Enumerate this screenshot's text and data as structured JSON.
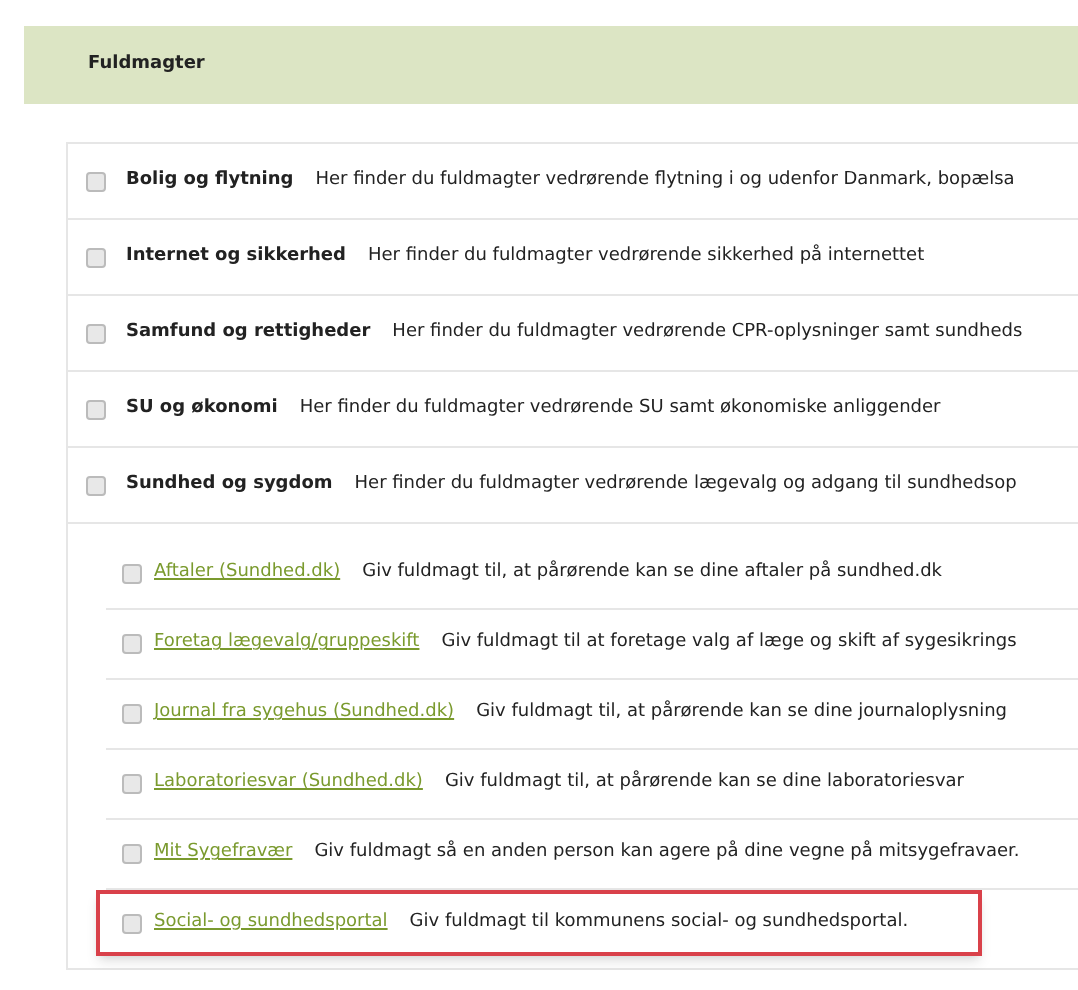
{
  "header": {
    "title": "Fuldmagter"
  },
  "categories": [
    {
      "label": "Bolig og flytning",
      "description": "Her finder du fuldmagter vedrørende flytning i og udenfor Danmark, bopælsa",
      "checked": false
    },
    {
      "label": "Internet og sikkerhed",
      "description": "Her finder du fuldmagter vedrørende sikkerhed på internettet",
      "checked": false
    },
    {
      "label": "Samfund og rettigheder",
      "description": "Her finder du fuldmagter vedrørende CPR-oplysninger samt sundheds",
      "checked": false
    },
    {
      "label": "SU og økonomi",
      "description": "Her finder du fuldmagter vedrørende SU samt økonomiske anliggender",
      "checked": false
    },
    {
      "label": "Sundhed og sygdom",
      "description": "Her finder du fuldmagter vedrørende lægevalg og adgang til sundhedsop",
      "checked": false,
      "children": [
        {
          "label": "Aftaler (Sundhed.dk)",
          "description": "Giv fuldmagt til, at pårørende kan se dine aftaler på sundhed.dk",
          "checked": false,
          "highlighted": false
        },
        {
          "label": "Foretag lægevalg/gruppeskift",
          "description": "Giv fuldmagt til at foretage valg af læge og skift af sygesikrings",
          "checked": false,
          "highlighted": false
        },
        {
          "label": "Journal fra sygehus (Sundhed.dk)",
          "description": "Giv fuldmagt til, at pårørende kan se dine journaloplysning",
          "checked": false,
          "highlighted": false
        },
        {
          "label": "Laboratoriesvar (Sundhed.dk)",
          "description": "Giv fuldmagt til, at pårørende kan se dine laboratoriesvar",
          "checked": false,
          "highlighted": false
        },
        {
          "label": "Mit Sygefravær",
          "description": "Giv fuldmagt så en anden person kan agere på dine vegne på mitsygefravaer.",
          "checked": false,
          "highlighted": false
        },
        {
          "label": "Social- og sundhedsportal",
          "description": "Giv fuldmagt til kommunens social- og sundhedsportal.",
          "checked": false,
          "highlighted": true
        }
      ]
    }
  ]
}
